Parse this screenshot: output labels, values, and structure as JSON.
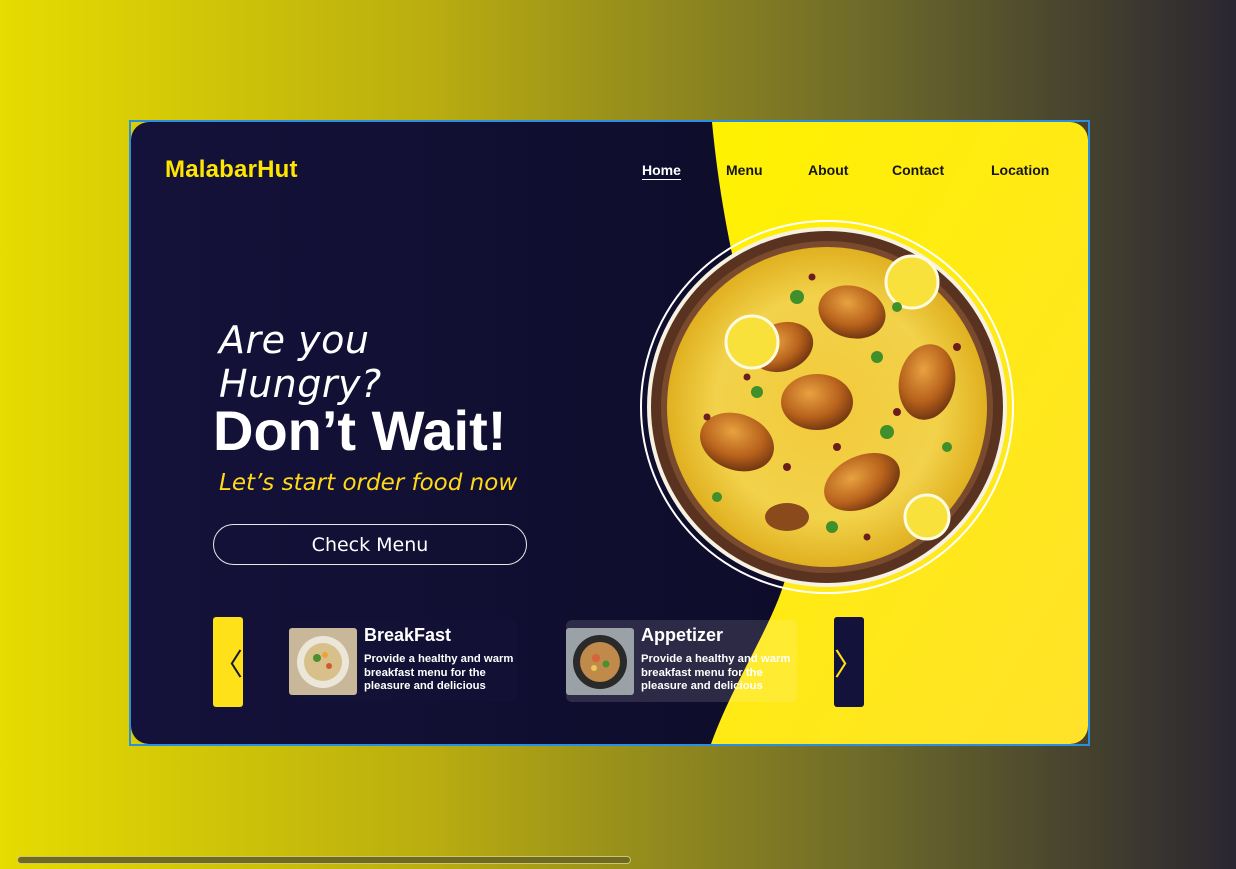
{
  "brand": {
    "logo": "MalabarHut"
  },
  "nav": {
    "items": [
      {
        "label": "Home",
        "active": true
      },
      {
        "label": "Menu",
        "active": false
      },
      {
        "label": "About",
        "active": false
      },
      {
        "label": "Contact",
        "active": false
      },
      {
        "label": "Location",
        "active": false
      }
    ]
  },
  "hero": {
    "question": "Are you Hungry?",
    "headline": "Don’t Wait!",
    "tagline": "Let’s start order food now",
    "cta_label": "Check Menu"
  },
  "carousel": {
    "prev_icon": "chevron-left-icon",
    "next_icon": "chevron-right-icon",
    "prev_glyph": "〈",
    "next_glyph": "〉",
    "cards": [
      {
        "title": "BreakFast",
        "description": "Provide a healthy and warm breakfast menu for the pleasure and delicious"
      },
      {
        "title": "Appetizer",
        "description": "Provide a healthy and warm breakfast menu for the pleasure and delicious"
      }
    ]
  },
  "colors": {
    "accent": "#ffe600",
    "dark_panel": "#13123a",
    "selection_border": "#2a8fe0"
  }
}
